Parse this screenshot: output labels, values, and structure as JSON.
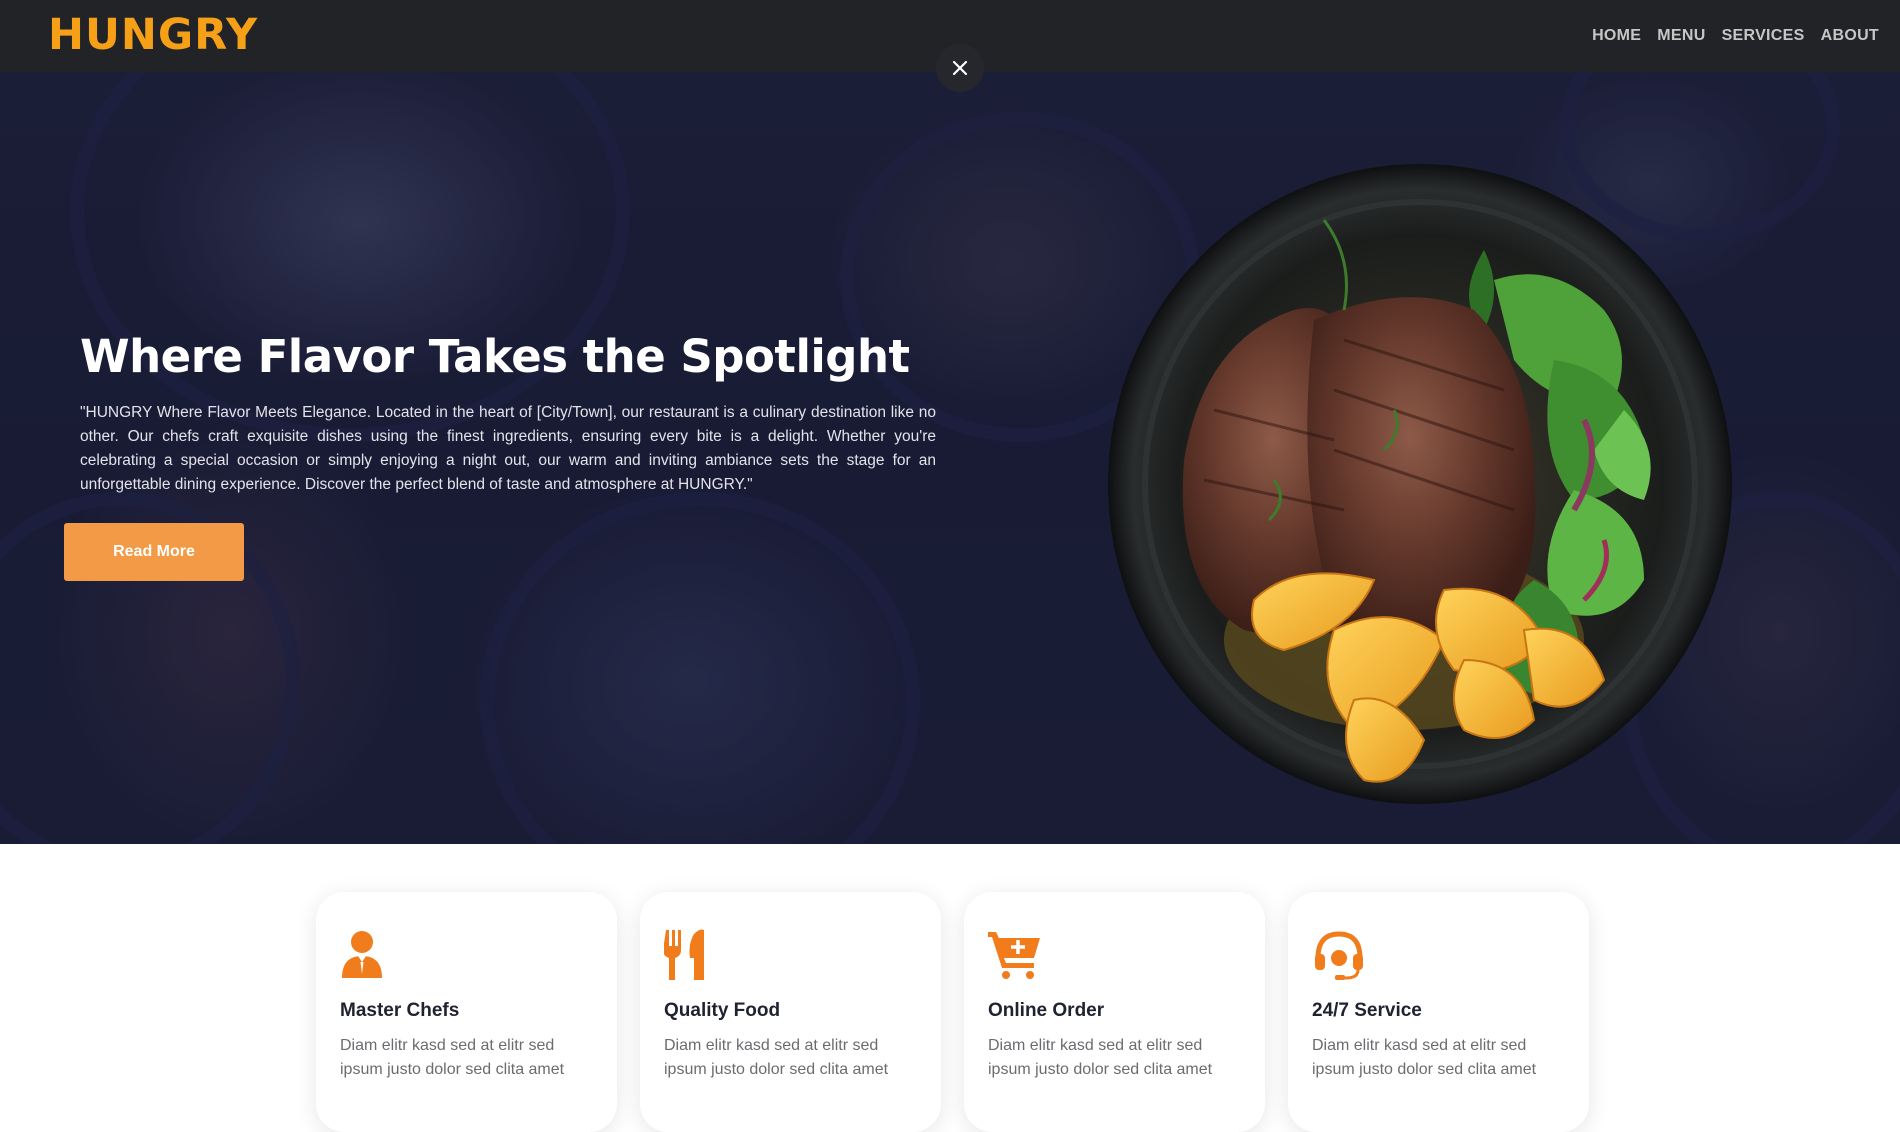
{
  "navbar": {
    "brand": "HUNGRY",
    "links": [
      "HOME",
      "MENU",
      "SERVICES",
      "ABOUT"
    ]
  },
  "hero": {
    "title": "Where Flavor Takes the Spotlight",
    "text": "\"HUNGRY Where Flavor Meets Elegance. Located in the heart of [City/Town], our restaurant is a culinary destination like no other. Our chefs craft exquisite dishes using the finest ingredients, ensuring every bite is a delight. Whether you're celebrating a special occasion or simply enjoying a night out, our warm and inviting ambiance sets the stage for an unforgettable dining experience. Discover the perfect blend of taste and atmosphere at HUNGRY.\"",
    "button": "Read More",
    "close_icon": "close-icon"
  },
  "services": [
    {
      "icon": "chef-icon",
      "title": "Master Chefs",
      "text": "Diam elitr kasd sed at elitr sed ipsum justo dolor sed clita amet"
    },
    {
      "icon": "utensils-icon",
      "title": "Quality Food",
      "text": "Diam elitr kasd sed at elitr sed ipsum justo dolor sed clita amet"
    },
    {
      "icon": "cart-plus-icon",
      "title": "Online Order",
      "text": "Diam elitr kasd sed at elitr sed ipsum justo dolor sed clita amet"
    },
    {
      "icon": "headset-icon",
      "title": "24/7 Service",
      "text": "Diam elitr kasd sed at elitr sed ipsum justo dolor sed clita amet"
    }
  ],
  "colors": {
    "brand": "#f6a018",
    "accent": "#f29a45",
    "icon_orange": "#f07c1c",
    "navbar_bg": "#222326",
    "hero_bg": "#1b1d36"
  }
}
